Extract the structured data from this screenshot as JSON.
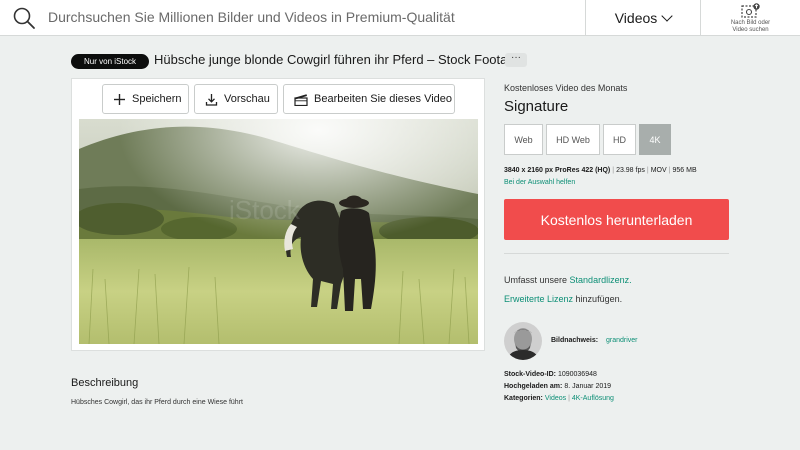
{
  "header": {
    "search_placeholder": "Durchsuchen Sie Millionen Bilder und Videos in Premium-Qualität",
    "media_dropdown": "Videos",
    "image_search_line1": "Nach Bild oder",
    "image_search_line2": "Video suchen"
  },
  "title_row": {
    "badge": "Nur von iStock",
    "title": "Hübsche junge blonde Cowgirl führen ihr Pferd – Stock Footage",
    "more": "···"
  },
  "toolbar": {
    "save": "Speichern",
    "preview": "Vorschau",
    "edit": "Bearbeiten Sie dieses Video"
  },
  "description": {
    "heading": "Beschreibung",
    "text": "Hübsches Cowgirl, das ihr Pferd durch eine Wiese führt"
  },
  "sidebar": {
    "promo": "Kostenloses Video des Monats",
    "collection": "Signature",
    "resolutions": [
      "Web",
      "HD Web",
      "HD",
      "4K"
    ],
    "active_resolution": "4K",
    "specs": {
      "size": "3840 x 2160 px ProRes 422 (HQ)",
      "fps": "23.98 fps",
      "format": "MOV",
      "filesize": "956 MB"
    },
    "help_link": "Bei der Auswahl helfen",
    "download_button": "Kostenlos herunterladen",
    "license_prefix": "Umfasst unsere",
    "license_link": "Standardlizenz.",
    "extended_link": "Erweiterte Lizenz",
    "extended_suffix": "hinzufügen.",
    "credit_label": "Bildnachweis:",
    "credit_name": "grandriver",
    "stock_id_label": "Stock-Video-ID:",
    "stock_id": "1090036948",
    "uploaded_label": "Hochgeladen am:",
    "uploaded": "8. Januar 2019",
    "categories_label": "Kategorien:",
    "category1": "Videos",
    "category2": "4K-Auflösung"
  },
  "colors": {
    "accent_green": "#0d8f76",
    "download_red": "#f14c4c",
    "badge_black": "#0c0d0d"
  }
}
